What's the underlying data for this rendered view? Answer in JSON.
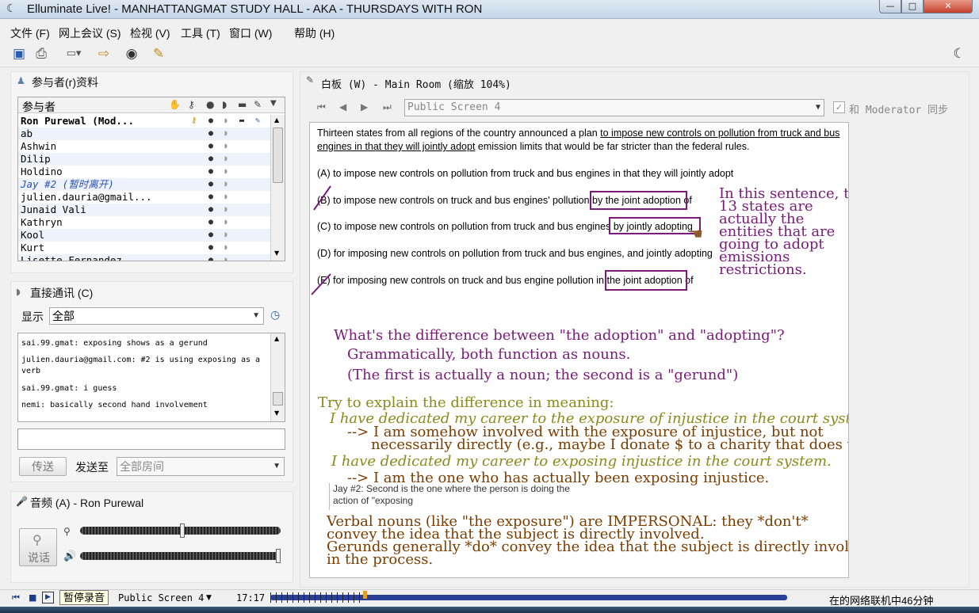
{
  "window": {
    "title": "Elluminate Live! - MANHATTANGMAT STUDY HALL - AKA - THURSDAYS WITH RON",
    "min": "—",
    "max": "□",
    "close": "✕"
  },
  "menu": [
    "文件 (F)",
    "网上会议 (S)",
    "检视 (V)",
    "工具 (T)",
    "窗口 (W)",
    "帮助 (H)"
  ],
  "participants": {
    "title": "参与者(r)资料",
    "header": "参与者",
    "rows": [
      {
        "name": "Ron Purewal (Mod...",
        "style": "bold"
      },
      {
        "name": "ab",
        "style": "normal"
      },
      {
        "name": "Ashwin",
        "style": "normal"
      },
      {
        "name": "Dilip",
        "style": "normal"
      },
      {
        "name": "Holdino",
        "style": "normal"
      },
      {
        "name": "Jay #2 (暂时离开)",
        "style": "away"
      },
      {
        "name": "julien.dauria@gmail...",
        "style": "normal"
      },
      {
        "name": "Junaid Vali",
        "style": "normal"
      },
      {
        "name": "Kathryn",
        "style": "normal"
      },
      {
        "name": "Kool",
        "style": "normal"
      },
      {
        "name": "Kurt",
        "style": "normal"
      },
      {
        "name": "Lisette Fernandez",
        "style": "normal"
      }
    ]
  },
  "chat": {
    "title": "直接通讯 (C)",
    "show_label": "显示",
    "filter_value": "全部",
    "messages": [
      "sai.99.gmat: exposing shows as a gerund",
      "julien.dauria@gmail.com: #2 is using exposing as a verb",
      "sai.99.gmat: i guess",
      "nemi: basically second hand involvement"
    ],
    "input_value": "",
    "send_label": "传送",
    "send_to_label": "发送至",
    "send_to_value": "全部房间"
  },
  "audio": {
    "title": "音频 (A) - Ron Purewal",
    "talk_label": "说话",
    "mic_level": 0.51,
    "speaker_level": 1.0
  },
  "whiteboard": {
    "title": "白板 (W) - Main Room (缩放 104%)",
    "screen_value": "Public Screen 4",
    "sync_label": "和 Moderator 同步",
    "question": {
      "lead_plain": "Thirteen states from all regions of the country announced a plan ",
      "lead_underlined": "to impose new controls on pollution from truck and bus",
      "line2_underlined": "engines in that they will jointly adopt",
      "line2_plain": " emission limits that would be far stricter than the federal rules."
    },
    "options": {
      "a": "(A) to impose new controls on pollution from truck and bus engines in that they will jointly adopt",
      "b_pre": "(B) to impose new controls on truck and bus engines' pollution ",
      "b_box": "by the joint adoption",
      "b_post": " of",
      "c_pre": "(C) to impose new controls on pollution from truck and bus engines ",
      "c_box": "by jointly adopting",
      "d": "(D) for imposing new controls on pollution from truck and bus engines, and jointly adopting",
      "e_pre": "(E) for imposing new controls on truck and bus engine pollution in ",
      "e_box": "the joint adoption",
      "e_post": " of"
    },
    "side_note": [
      "In this sentence, the",
      "13 states are",
      "actually the",
      "entities that are",
      "going to adopt",
      "emissions",
      "restrictions."
    ],
    "q1": "What's the difference between \"the adoption\" and \"adopting\"?",
    "q1a": "Grammatically, both function as nouns.",
    "q1b": "(The first is actually a noun; the second is a \"gerund\")",
    "t1": "Try to explain the difference in meaning:",
    "ex1": "I have dedicated my career to the exposure of injustice in the court system.",
    "ex1a": "--> I am somehow involved with the exposure of injustice, but not",
    "ex1b": "necessarily directly (e.g., maybe I donate $ to a charity that does this)",
    "ex2": "I have dedicated my career to exposing injustice in the court system.",
    "ex2a": "--> I am the one who has actually been exposing injustice.",
    "chat_note": [
      "Jay #2: Second is the one where the person is doing the",
      "action of \"exposing"
    ],
    "concl": [
      "Verbal nouns (like \"the exposure\") are IMPERSONAL: they *don't*",
      "convey the idea that the subject is directly involved.",
      "Gerunds generally *do* convey the idea that the subject is directly involved",
      "in the process."
    ],
    "colors": {
      "purple": "#7a1a7a",
      "olive": "#8a8a1a",
      "brown": "#7a3d00"
    }
  },
  "status": {
    "tooltip": "暂停录音",
    "screen": "Public Screen 4",
    "time": "17:17",
    "online": "在的网络联机中46分钟",
    "playback_progress": 0.18
  }
}
